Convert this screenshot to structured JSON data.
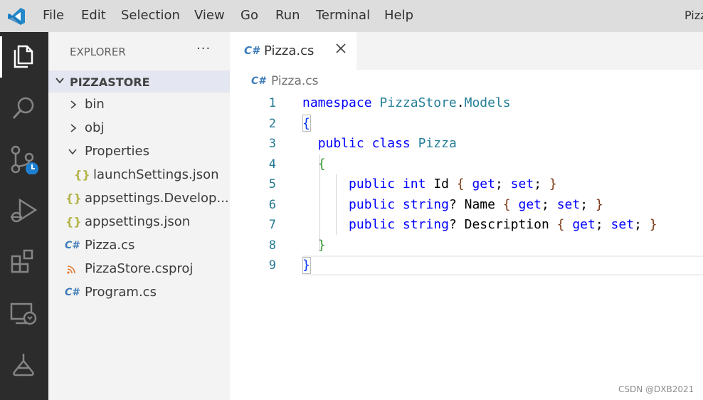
{
  "menu": {
    "items": [
      "File",
      "Edit",
      "Selection",
      "View",
      "Go",
      "Run",
      "Terminal",
      "Help"
    ],
    "window_title": "Pizz"
  },
  "activity_bar": {
    "icons": [
      "explorer-icon",
      "search-icon",
      "source-control-icon",
      "run-debug-icon",
      "extensions-icon",
      "remote-explorer-icon",
      "testing-icon"
    ]
  },
  "explorer": {
    "title": "EXPLORER",
    "more": "···",
    "section": "PIZZASTORE",
    "items": [
      {
        "label": "bin",
        "kind": "folder-collapsed"
      },
      {
        "label": "obj",
        "kind": "folder-collapsed"
      },
      {
        "label": "Properties",
        "kind": "folder-expanded"
      },
      {
        "label": "launchSettings.json",
        "kind": "json"
      },
      {
        "label": "appsettings.Develop...",
        "kind": "json"
      },
      {
        "label": "appsettings.json",
        "kind": "json"
      },
      {
        "label": "Pizza.cs",
        "kind": "csharp"
      },
      {
        "label": "PizzaStore.csproj",
        "kind": "rss"
      },
      {
        "label": "Program.cs",
        "kind": "csharp"
      }
    ],
    "icon_glyphs": {
      "json": "{}",
      "csharp": "C#",
      "rss": "⋱"
    }
  },
  "editor": {
    "tab_label": "Pizza.cs",
    "tab_icon": "C#",
    "breadcrumb": "Pizza.cs",
    "line_numbers": [
      "1",
      "2",
      "3",
      "4",
      "5",
      "6",
      "7",
      "8",
      "9"
    ],
    "tokens": {
      "namespace_kw": "namespace",
      "namespace_name": "PizzaStore",
      "dot": ".",
      "namespace_sub": "Models",
      "brace_open": "{",
      "brace_close": "}",
      "public_kw": "public",
      "class_kw": "class",
      "class_name": "Pizza",
      "int_kw": "int",
      "string_kw": "string",
      "id_prop": " Id ",
      "name_prop": "? Name ",
      "desc_prop": "? Description ",
      "get_kw": "get",
      "set_kw": "set",
      "semicolon": ";"
    }
  },
  "watermark": "CSDN @DXB2021",
  "colors": {
    "titlebar": "#dddddd",
    "activity_bar": "#2c2c2c",
    "sidebar": "#f3f3f3",
    "keyword": "#0000ff",
    "type": "#267f99",
    "line_number": "#237893"
  }
}
